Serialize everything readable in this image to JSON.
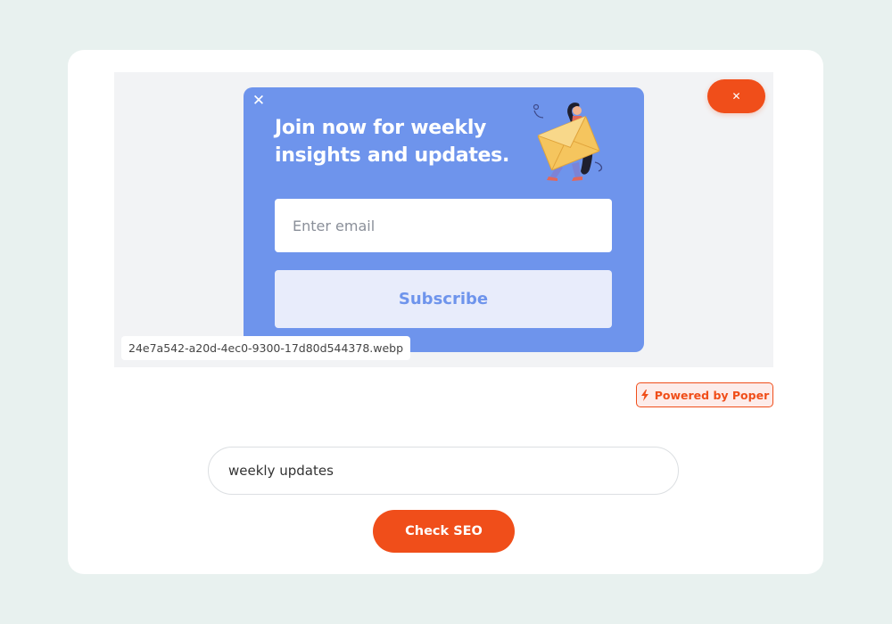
{
  "preview": {
    "popup": {
      "close_glyph": "✕",
      "headline": "Join now for weekly insights and updates.",
      "email_placeholder": "Enter email",
      "subscribe_label": "Subscribe",
      "illustration": "woman-with-envelope-illustration",
      "bg_color": "#6e94ec"
    },
    "filename": "24e7a542-a20d-4ec0-9300-17d80d544378.webp",
    "close_button_glyph": "✕"
  },
  "powered_by": {
    "label": "Powered by Poper",
    "icon": "lightning-bolt-icon"
  },
  "keyword_input": {
    "value": "weekly updates"
  },
  "check_seo": {
    "label": "Check SEO"
  },
  "colors": {
    "accent": "#f04e1a",
    "page_bg": "#e8f1ef"
  }
}
